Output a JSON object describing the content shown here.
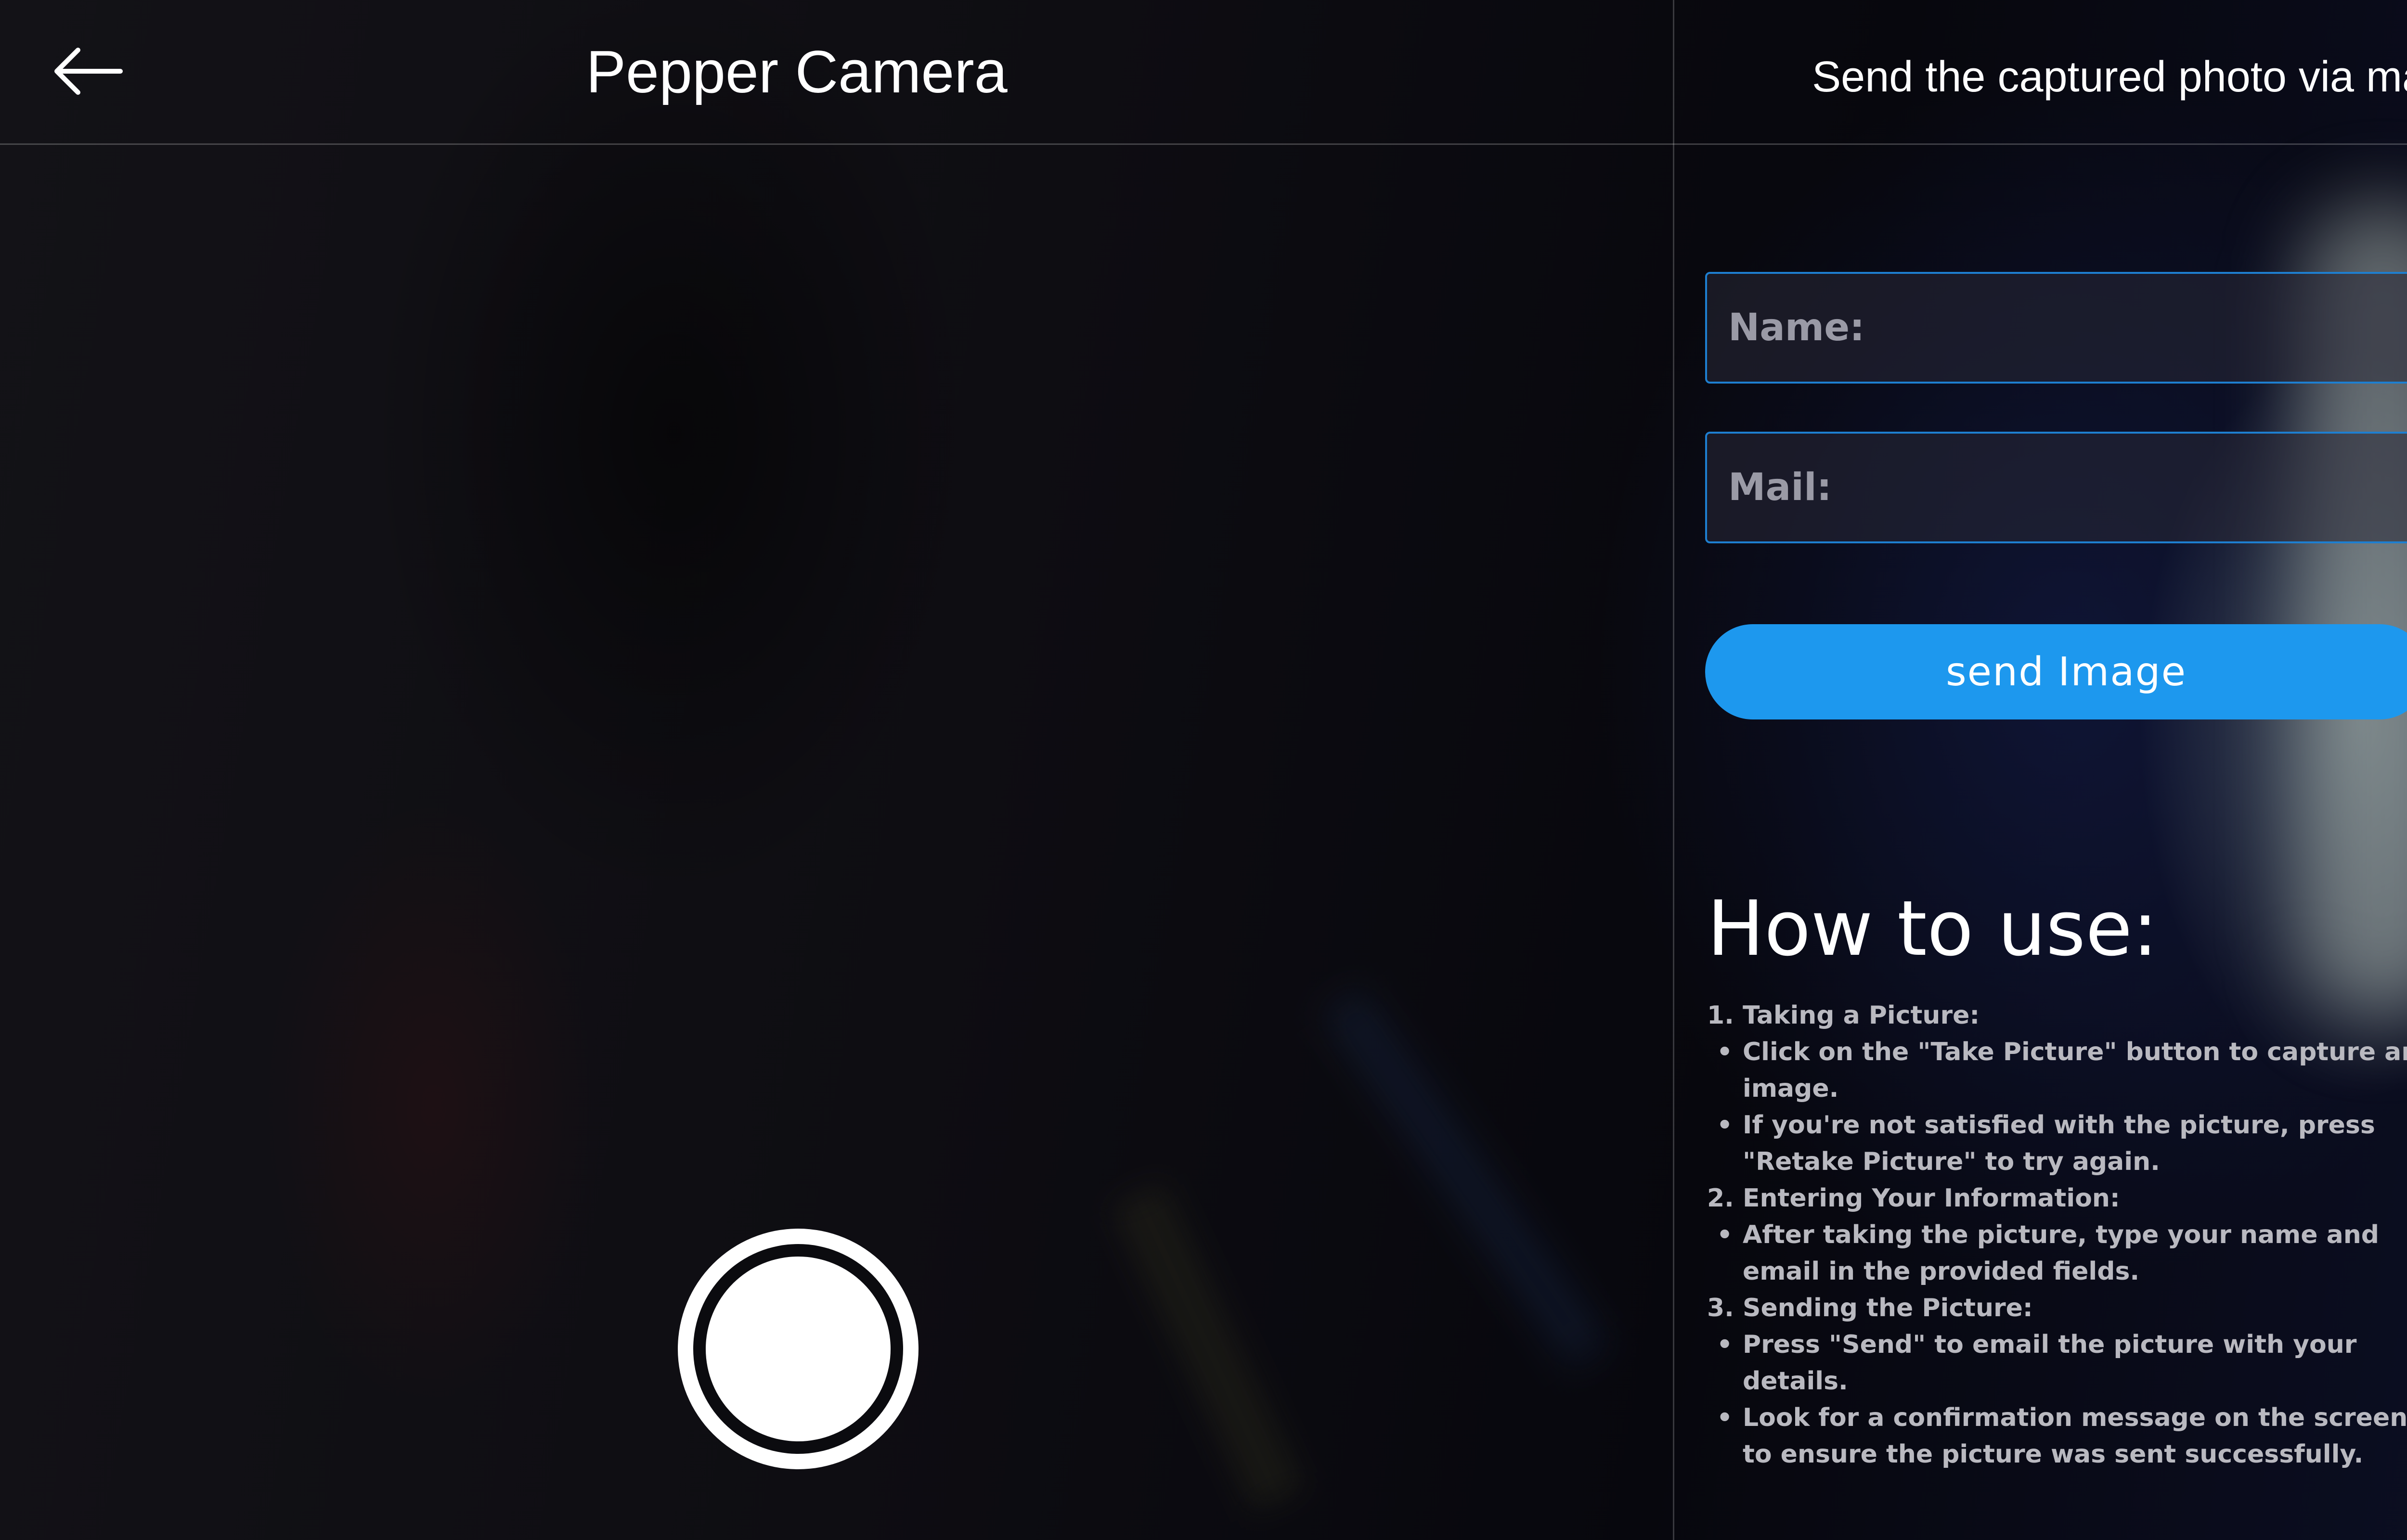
{
  "header": {
    "back_icon": "arrow-left-icon",
    "title": "Pepper Camera",
    "panel_title": "Send the captured photo via mail"
  },
  "camera": {
    "shutter_icon": "shutter-button-icon"
  },
  "form": {
    "name_placeholder": "Name:",
    "mail_placeholder": "Mail:",
    "send_label": "send Image"
  },
  "howto": {
    "heading": "How to use:",
    "steps": [
      {
        "num": "1.",
        "title": "Taking a Picture:",
        "bullets": [
          "Click on the \"Take Picture\" button to capture an image.",
          "If you're not satisfied with the picture, press \"Retake Picture\" to try again."
        ]
      },
      {
        "num": "2.",
        "title": "Entering Your Information:",
        "bullets": [
          "After taking the picture, type your name and email in the provided fields."
        ]
      },
      {
        "num": "3.",
        "title": "Sending the Picture:",
        "bullets": [
          "Press \"Send\" to email the picture with your details.",
          "Look for a confirmation message on the screen to ensure the picture was sent successfully."
        ]
      }
    ]
  },
  "colors": {
    "accent": "#1d98ee",
    "field_border": "#1e7fd0",
    "text": "#ffffff",
    "muted_text": "#b9b9c0"
  }
}
